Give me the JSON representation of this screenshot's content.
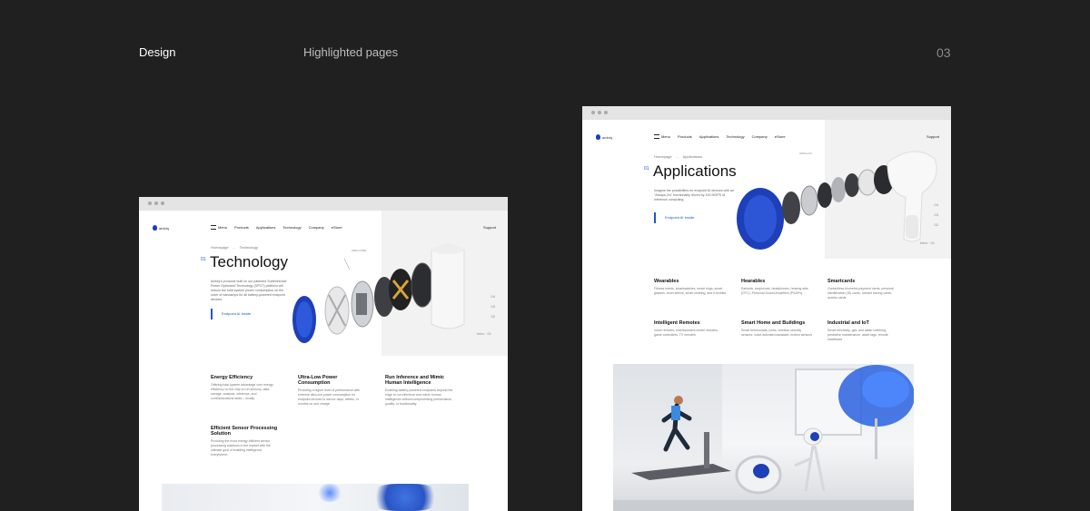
{
  "header": {
    "section": "Design",
    "subtitle": "Highlighted pages",
    "page_number": "03"
  },
  "window1": {
    "logo": "ambiq",
    "nav": [
      "Menu",
      "Products",
      "Applications",
      "Technology",
      "Company",
      "eStore"
    ],
    "support": "Support",
    "breadcrumb": [
      "Homepage",
      "Technology"
    ],
    "index": "01",
    "title": "Technology",
    "description": "Ambiq's products built on our patented Subthreshold Power Optimized Technology (SPOT) platform will reduce the total system power consumption on the order of nanoamps for all battery-powered endpoint devices.",
    "link": "Endpoint AI Inside",
    "callout": "ARM CORE",
    "pager": [
      "01",
      "02",
      "03",
      "04"
    ],
    "pager_active": "Intro · 01",
    "features": [
      {
        "title": "Energy Efficiency",
        "text": "Offering total system advantage over energy efficiency on the chip to run sensory, data storage, analysis, inference, and communications tasks – locally."
      },
      {
        "title": "Ultra-Low Power Consumption",
        "text": "Providing a higher level of performance with extreme ultra-low power consumption for endpoint devices to last for days, weeks, or months on one charge."
      },
      {
        "title": "Run Inference and Mimic Human Intelligence",
        "text": "Enabling battery-powered endpoints beyond the edge to run inference and mimic human intelligence without compromising performance, quality, or functionality."
      },
      {
        "title": "Efficient Sensor Processing Solution",
        "text": "Providing the most energy-efficient sensor processing solutions in the market with the ultimate goal of enabling intelligence everywhere."
      }
    ]
  },
  "window2": {
    "logo": "ambiq",
    "nav": [
      "Menu",
      "Products",
      "Applications",
      "Technology",
      "Company",
      "eStore"
    ],
    "support": "Support",
    "breadcrumb": [
      "Homepage",
      "Applications"
    ],
    "index": "01",
    "title": "Applications",
    "description": "Imagine the possibilities for endpoint AI devices with an \"Always-On\" functionality driven by 100 MOPS of inference computing.",
    "link": "Endpoint AI Inside",
    "callout": "APOLLO4",
    "pager": [
      "01",
      "02",
      "03",
      "04"
    ],
    "pager_active": "Intro · 01",
    "apps": [
      {
        "title": "Wearables",
        "text": "Fitness bands, smartwatches, smart rings, smart glasses, short sleeve, smart clothing, and e-textiles"
      },
      {
        "title": "Hearables",
        "text": "Earbuds, earphones, headphones, hearing aids (OTC), Personal Sound Amplifiers (PSAPs)"
      },
      {
        "title": "Smartcards",
        "text": "Contactless biometric payment cards, personal identification (ID) cards, contact tracing cards, access cards"
      },
      {
        "title": "Intelligent Remotes",
        "text": "Voice remotes, entertainment center remotes, game controllers, TV remotes"
      },
      {
        "title": "Smart Home and Buildings",
        "text": "Smart thermostats, locks, wireless security sensors, voice-activated assistant, motion sensors"
      },
      {
        "title": "Industrial and IoT",
        "text": "Smart electricity, gas, and water metering, predictive maintenance, asset tags, remote healthcare"
      }
    ]
  },
  "colors": {
    "background": "#202020",
    "accent": "#1d57c9",
    "chip_blue": "#1d3fb8"
  }
}
